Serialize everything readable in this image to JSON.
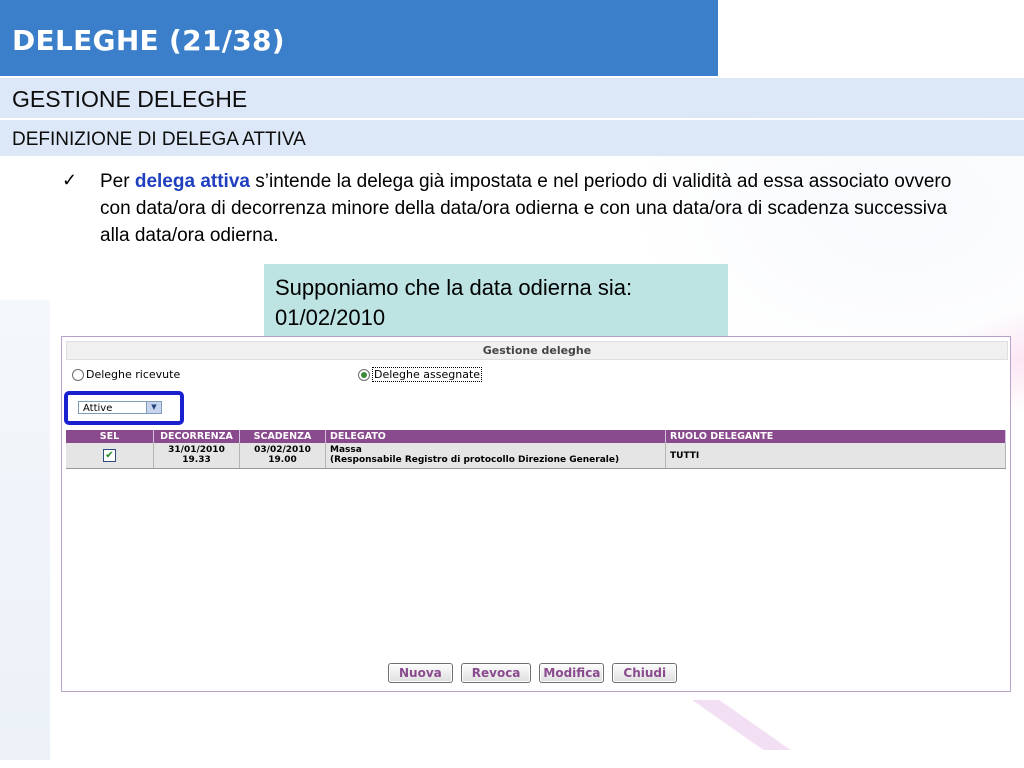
{
  "slide": {
    "title": "DELEGHE (21/38)",
    "section": "GESTIONE DELEGHE",
    "subsection": "DEFINIZIONE DI DELEGA ATTIVA"
  },
  "body": {
    "bullet_icon": "checkmark-icon",
    "text_before": "Per ",
    "highlight": "delega attiva",
    "text_after": " s’intende la delega già impostata e nel periodo di validità ad essa associato ovvero con data/ora di decorrenza minore della data/ora odierna e con una data/ora di scadenza successiva alla data/ora odierna.",
    "highlight_color": "#1f3fbf"
  },
  "note": {
    "text": "Supponiamo che la data odierna sia: 01/02/2010"
  },
  "app": {
    "header": "Gestione deleghe",
    "radio_received": "Deleghe ricevute",
    "radio_assigned": "Deleghe assegnate",
    "selected_radio": "Deleghe assegnate",
    "filter_value": "Attive",
    "columns": [
      "SEL",
      "DECORRENZA",
      "SCADENZA",
      "DELEGATO",
      "RUOLO DELEGANTE"
    ],
    "rows": [
      {
        "selected": true,
        "decorrenza_date": "31/01/2010",
        "decorrenza_time": "19.33",
        "scadenza_date": "03/02/2010",
        "scadenza_time": "19.00",
        "delegato_name": "Massa",
        "delegato_role": "(Responsabile Registro di protocollo Direzione Generale)",
        "ruolo_delegante": "TUTTI"
      }
    ],
    "buttons": {
      "new": "Nuova",
      "revoke": "Revoca",
      "modify": "Modifica",
      "close": "Chiudi"
    }
  },
  "colors": {
    "title_bar": "#3b7fcb",
    "band": "#dce8f7",
    "note_bg": "#bde3e3",
    "grid_header": "#8a4a8e",
    "highlight_frame": "#1a1fd0"
  }
}
